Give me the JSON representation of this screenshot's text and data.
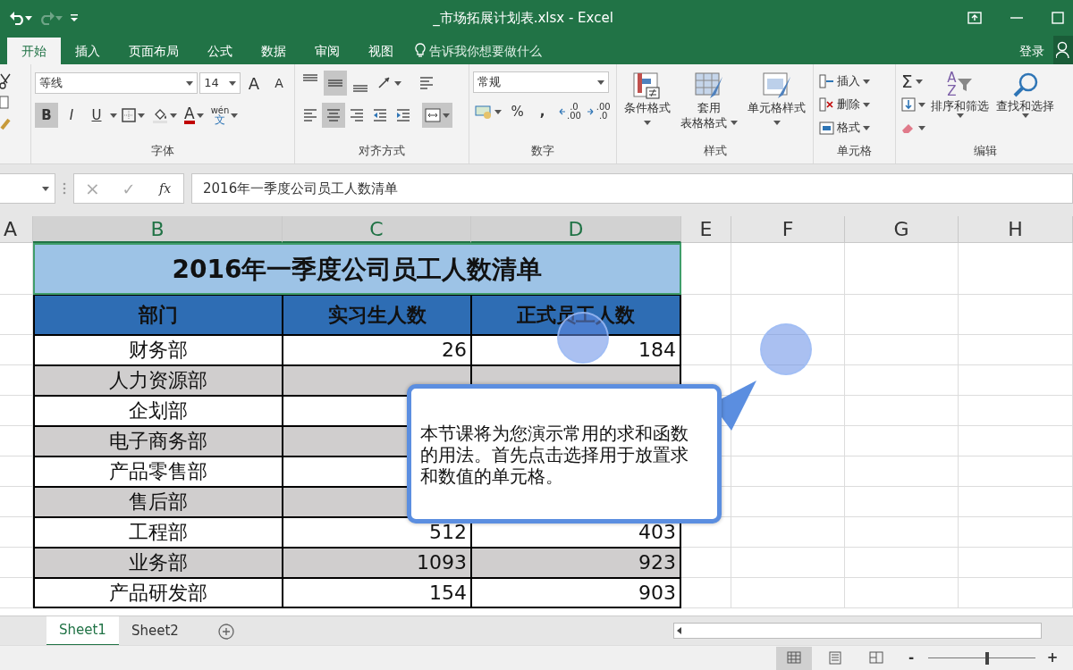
{
  "quick_access": {
    "undo": {
      "disabled": false
    },
    "redo": {
      "disabled": true
    }
  },
  "window": {
    "title": "_市场拓展计划表.xlsx - Excel"
  },
  "tabs": [
    {
      "label": "开始",
      "selected": true
    },
    {
      "label": "插入",
      "selected": false
    },
    {
      "label": "页面布局",
      "selected": false
    },
    {
      "label": "公式",
      "selected": false
    },
    {
      "label": "数据",
      "selected": false
    },
    {
      "label": "审阅",
      "selected": false
    },
    {
      "label": "视图",
      "selected": false
    }
  ],
  "tell_me": {
    "placeholder": "告诉我你想要做什么"
  },
  "account": {
    "label": "登录"
  },
  "font_group": {
    "label": "字体",
    "font_name": "等线",
    "font_size": "14",
    "grow": "A",
    "shrink": "A",
    "bold": {
      "label": "B",
      "pressed": true
    },
    "italic": {
      "label": "I",
      "pressed": false
    },
    "underline": {
      "label": "U",
      "pressed": false
    },
    "font_color": "A",
    "phonetic": {
      "top": "wén",
      "bottom": "文"
    }
  },
  "alignment_group": {
    "label": "对齐方式",
    "buttons": [
      {
        "pressed": false
      },
      {
        "pressed": true
      },
      {
        "pressed": false
      },
      {
        "pressed": false
      },
      {
        "pressed": false
      },
      {
        "pressed": false
      },
      {
        "pressed": true
      },
      {
        "pressed": false
      },
      {
        "pressed": false
      },
      {
        "pressed": false
      },
      {
        "pressed": true
      }
    ]
  },
  "number_group": {
    "label": "数字",
    "format": "常规",
    "percent": "%",
    "comma": ",",
    "decrease_decimal": [
      ".0",
      ".00"
    ],
    "increase_decimal": [
      ".00",
      ".0"
    ]
  },
  "styles_group": {
    "label": "样式",
    "buttons": [
      {
        "lines": [
          "条件格式"
        ]
      },
      {
        "lines": [
          "套用",
          "表格格式"
        ]
      },
      {
        "lines": [
          "单元格样式"
        ]
      }
    ]
  },
  "cells_group": {
    "label": "单元格",
    "buttons": [
      "插入",
      "删除",
      "格式"
    ]
  },
  "editing_group": {
    "label": "编辑",
    "sum": "Σ",
    "sort_letters": [
      "A",
      "Z"
    ],
    "buttons": [
      "排序和筛选",
      "查找和选择"
    ]
  },
  "formula_bar": {
    "cancel": "×",
    "enter": "✓",
    "function": "fx",
    "disabled": true,
    "content": "2016年一季度公司员工人数清单"
  },
  "columns": [
    {
      "label": "A",
      "selected": false
    },
    {
      "label": "B",
      "selected": true
    },
    {
      "label": "C",
      "selected": true
    },
    {
      "label": "D",
      "selected": true
    },
    {
      "label": "E",
      "selected": false
    },
    {
      "label": "F",
      "selected": false
    },
    {
      "label": "G",
      "selected": false
    },
    {
      "label": "H",
      "selected": false
    }
  ],
  "table": {
    "title": "2016年一季度公司员工人数清单",
    "title_selected": true,
    "headers": [
      "部门",
      "实习生人数",
      "正式员工人数"
    ],
    "rows": [
      {
        "dept": "财务部",
        "interns": "26",
        "staff": "184"
      },
      {
        "dept": "人力资源部"
      },
      {
        "dept": "企划部"
      },
      {
        "dept": "电子商务部"
      },
      {
        "dept": "产品零售部"
      },
      {
        "dept": "售后部"
      },
      {
        "dept": "工程部",
        "interns": "512",
        "staff": "403"
      },
      {
        "dept": "业务部",
        "interns": "1093",
        "staff": "923"
      },
      {
        "dept": "产品研发部",
        "interns": "154",
        "staff": "903"
      }
    ]
  },
  "callout": {
    "text": "本节课将为您演示常用的求和函数的用法。首先点击选择用于放置求和数值的单元格。"
  },
  "sheets": [
    {
      "label": "Sheet1",
      "selected": true
    },
    {
      "label": "Sheet2",
      "selected": false
    }
  ],
  "status_bar": {
    "views": [
      {
        "selected": true
      },
      {
        "selected": false
      },
      {
        "selected": false
      }
    ],
    "zoom": {
      "minus": "-",
      "plus": "+",
      "level": 0.55
    }
  }
}
